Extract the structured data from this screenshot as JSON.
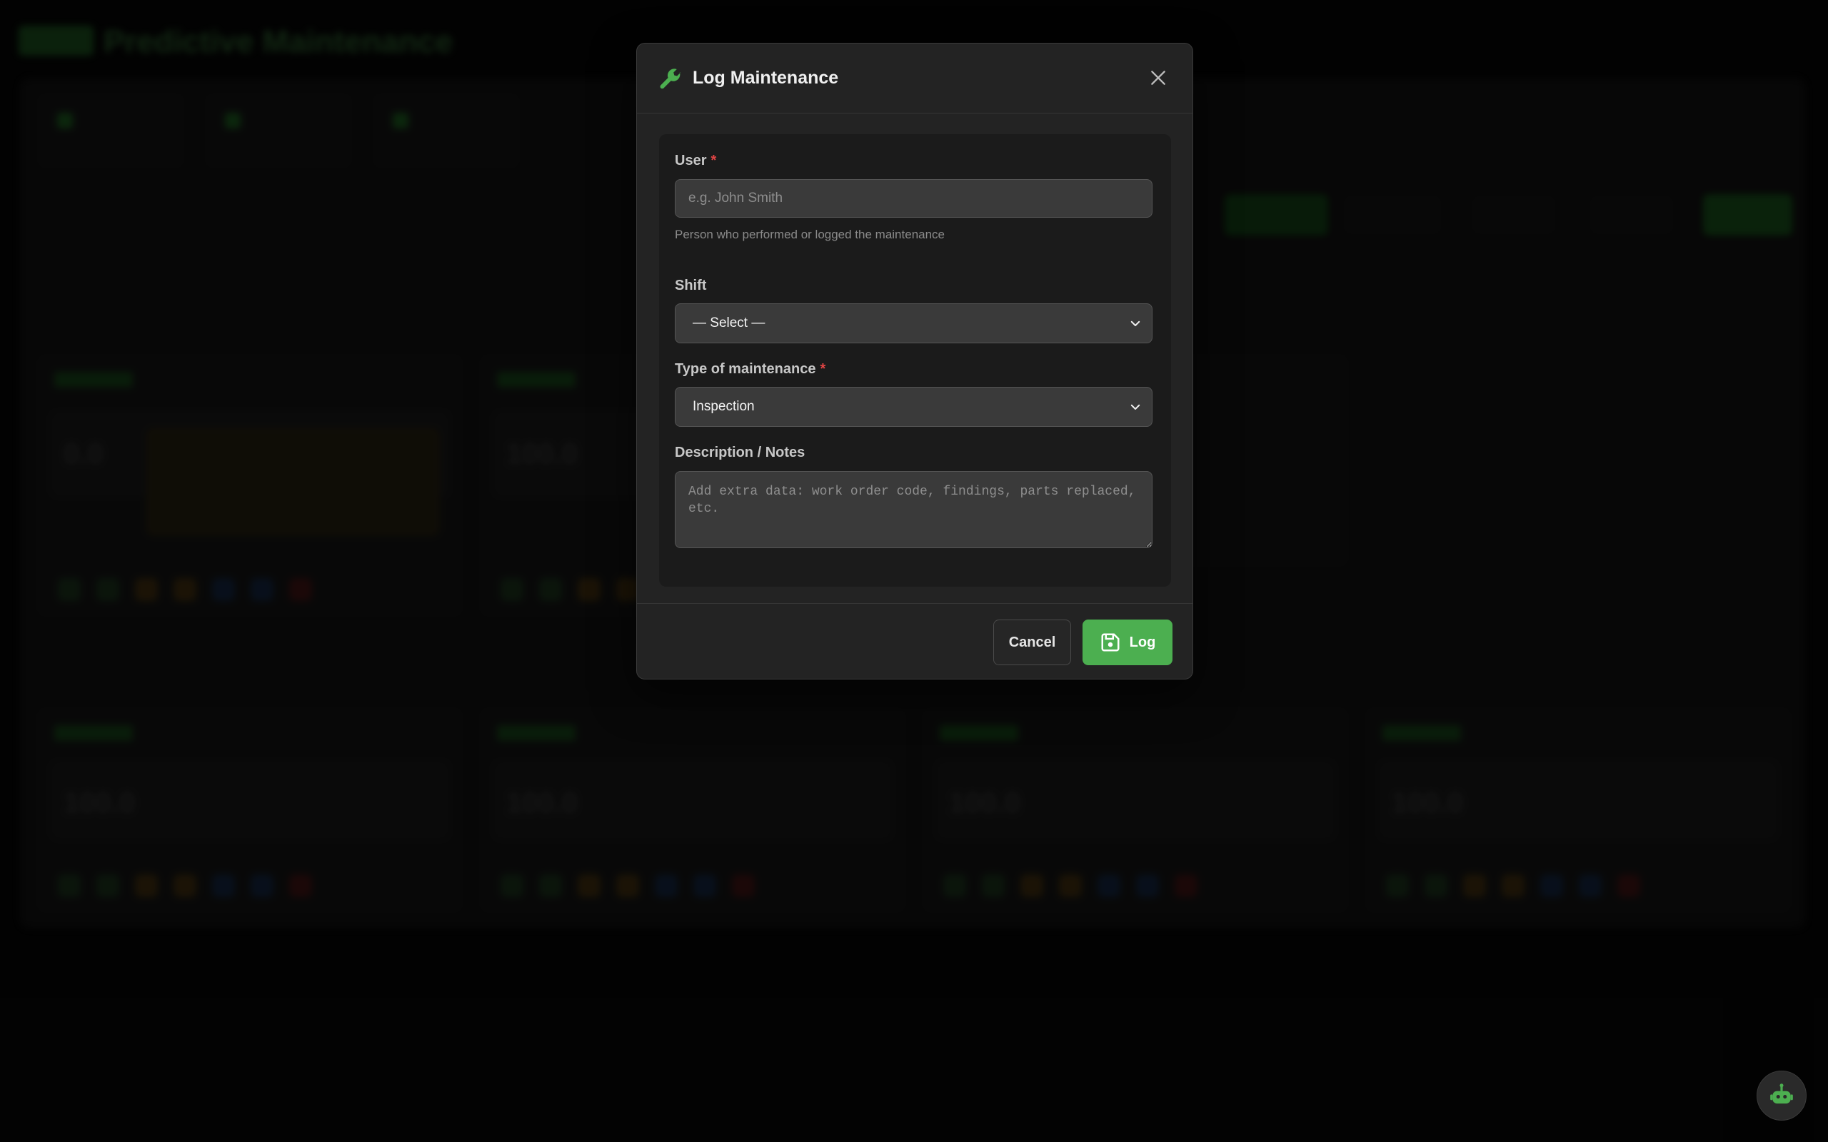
{
  "background": {
    "app_title": "Predictive Maintenance",
    "card_values": [
      "0.0",
      "100.0",
      "100.0",
      "100.0",
      "100.0",
      "100.0"
    ]
  },
  "modal": {
    "title": "Log Maintenance",
    "icon": "wrench-icon",
    "close_icon": "close-icon"
  },
  "form": {
    "user": {
      "label": "User",
      "required_mark": "*",
      "placeholder": "e.g. John Smith",
      "hint": "Person who performed or logged the maintenance"
    },
    "shift": {
      "label": "Shift",
      "selected": "— Select —"
    },
    "type": {
      "label": "Type of maintenance",
      "required_mark": "*",
      "selected": "Inspection"
    },
    "notes": {
      "label": "Description / Notes",
      "placeholder": "Add extra data: work order code, findings, parts replaced, etc."
    }
  },
  "footer": {
    "cancel_label": "Cancel",
    "log_label": "Log",
    "log_icon": "save-icon"
  },
  "colors": {
    "accent_green": "#4caf50",
    "required_red": "#e04444",
    "modal_bg": "#232323"
  },
  "assistant_button_icon": "robot-icon"
}
